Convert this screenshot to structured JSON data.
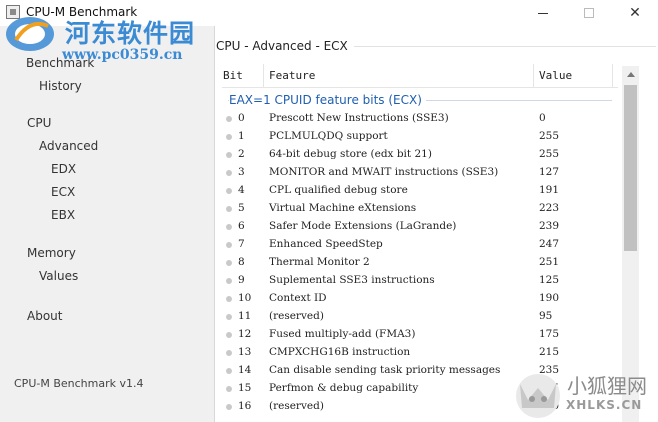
{
  "window": {
    "title": "CPU-M Benchmark"
  },
  "watermark": {
    "site_name": "河东软件园",
    "site_url": "www.pc0359.cn",
    "bottom_name": "小狐狸网",
    "bottom_url": "XHLKS.CN"
  },
  "sidebar": {
    "items": [
      {
        "label": "Benchmark"
      },
      {
        "label": "History"
      },
      {
        "label": "CPU"
      },
      {
        "label": "Advanced"
      },
      {
        "label": "EDX"
      },
      {
        "label": "ECX"
      },
      {
        "label": "EBX"
      },
      {
        "label": "Memory"
      },
      {
        "label": "Values"
      },
      {
        "label": "About"
      }
    ],
    "footer": "CPU-M Benchmark v1.4"
  },
  "main": {
    "title": "CPU - Advanced - ECX",
    "columns": {
      "bit": "Bit",
      "feature": "Feature",
      "value": "Value"
    },
    "section": "EAX=1 CPUID feature bits (ECX)",
    "rows": [
      {
        "bit": "0",
        "feature": "Prescott New Instructions (SSE3)",
        "value": "0"
      },
      {
        "bit": "1",
        "feature": "PCLMULQDQ support",
        "value": "255"
      },
      {
        "bit": "2",
        "feature": "64-bit debug store (edx bit 21)",
        "value": "255"
      },
      {
        "bit": "3",
        "feature": "MONITOR and MWAIT instructions (SSE3)",
        "value": "127"
      },
      {
        "bit": "4",
        "feature": "CPL qualified debug store",
        "value": "191"
      },
      {
        "bit": "5",
        "feature": "Virtual Machine eXtensions",
        "value": "223"
      },
      {
        "bit": "6",
        "feature": "Safer Mode Extensions (LaGrande)",
        "value": "239"
      },
      {
        "bit": "7",
        "feature": "Enhanced SpeedStep",
        "value": "247"
      },
      {
        "bit": "8",
        "feature": "Thermal Monitor 2",
        "value": "251"
      },
      {
        "bit": "9",
        "feature": "Suplemental SSE3 instructions",
        "value": "125"
      },
      {
        "bit": "10",
        "feature": "Context ID",
        "value": "190"
      },
      {
        "bit": "11",
        "feature": "(reserved)",
        "value": "95"
      },
      {
        "bit": "12",
        "feature": "Fused multiply-add (FMA3)",
        "value": "175"
      },
      {
        "bit": "13",
        "feature": "CMPXCHG16B instruction",
        "value": "215"
      },
      {
        "bit": "14",
        "feature": "Can disable sending task priority messages",
        "value": "235"
      },
      {
        "bit": "15",
        "feature": "Perfmon & debug capability",
        "value": "245"
      },
      {
        "bit": "16",
        "feature": "(reserved)",
        "value": "250"
      }
    ]
  },
  "colors": {
    "accent": "#1f5fb0",
    "sidebar_bg": "#f0f0f0",
    "watermark_blue": "#3a8ad4"
  },
  "icons": [
    "app-icon",
    "minimize-icon",
    "maximize-icon",
    "close-icon",
    "scroll-up-icon"
  ]
}
